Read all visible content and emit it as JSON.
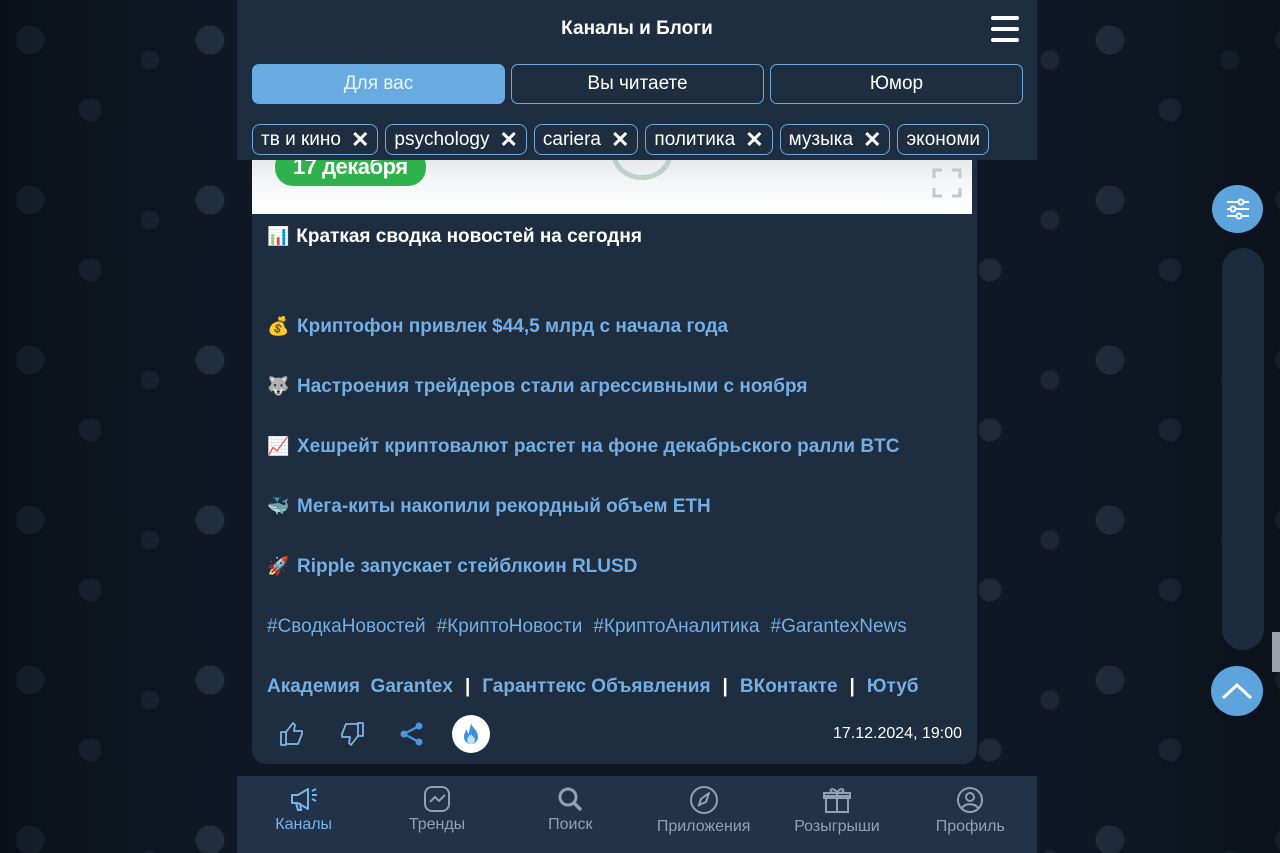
{
  "header": {
    "title": "Каналы и Блоги",
    "menu_icon": "hamburger-menu-icon"
  },
  "tabs": [
    {
      "label": "Для вас",
      "active": true
    },
    {
      "label": "Вы читаете",
      "active": false
    },
    {
      "label": "Юмор",
      "active": false
    }
  ],
  "chips": [
    {
      "label": "тв и кино"
    },
    {
      "label": "psychology"
    },
    {
      "label": "cariera"
    },
    {
      "label": "политика"
    },
    {
      "label": "музыка"
    },
    {
      "label": "экономи"
    }
  ],
  "chip_close": "✕",
  "post": {
    "banner_label": "17 декабря",
    "title_emoji": "📊",
    "title": "Краткая сводка новостей на сегодня",
    "news": [
      {
        "emoji": "💰",
        "text": "Криптофон привлек $44,5 млрд с начала года"
      },
      {
        "emoji": "🐺",
        "text": "Настроения трейдеров стали агрессивными с ноября"
      },
      {
        "emoji": "📈",
        "text": "Хешрейт криптовалют растет на фоне декабрьского ралли BTC"
      },
      {
        "emoji": "🐳",
        "text": "Мега-киты накопили рекордный объем ETH"
      },
      {
        "emoji": "🚀",
        "text": "Ripple запускает стейблкоин RLUSD"
      }
    ],
    "hashtags": [
      "#СводкаНовостей",
      "#КриптоНовости",
      "#КриптоАналитика",
      "#GarantexNews"
    ],
    "links": [
      "Академия  Garantex",
      "Гаранттекс Объявления",
      "ВКонтакте",
      "Ютуб"
    ],
    "link_separator": "|",
    "date": "17.12.2024, 19:00"
  },
  "bottom_nav": [
    {
      "label": "Каналы",
      "icon": "megaphone-icon",
      "active": true
    },
    {
      "label": "Тренды",
      "icon": "trends-icon",
      "active": false
    },
    {
      "label": "Поиск",
      "icon": "search-icon",
      "active": false
    },
    {
      "label": "Приложения",
      "icon": "rocket-icon",
      "active": false
    },
    {
      "label": "Розыгрыши",
      "icon": "gift-icon",
      "active": false
    },
    {
      "label": "Профиль",
      "icon": "profile-icon",
      "active": false
    }
  ],
  "colors": {
    "accent": "#67abe0",
    "link": "#74aee3",
    "panel": "#1e2d40",
    "banner_green": "#2fb24c"
  }
}
